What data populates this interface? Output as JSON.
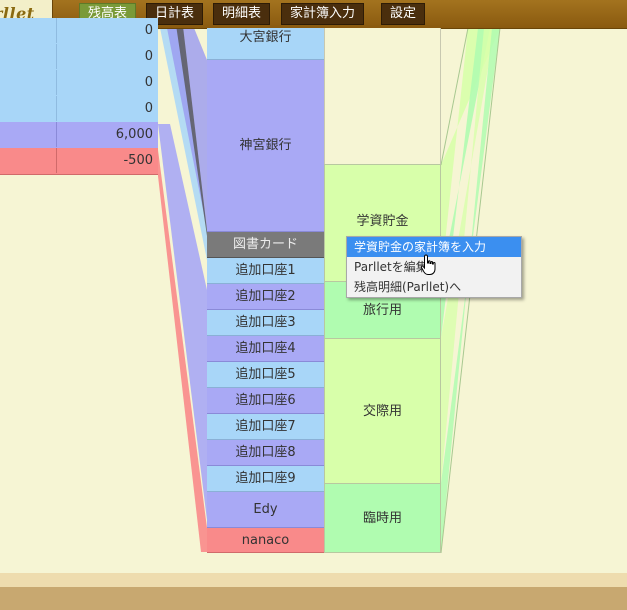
{
  "nav": {
    "logo_text": "rllet",
    "tabs": [
      {
        "label": "残高表",
        "active": true
      },
      {
        "label": "日計表",
        "active": false
      },
      {
        "label": "明細表",
        "active": false
      },
      {
        "label": "家計簿入力",
        "active": false
      },
      {
        "label": "設定",
        "active": false
      }
    ]
  },
  "left_table": {
    "rows": [
      {
        "value": "0",
        "color": "blue"
      },
      {
        "value": "0",
        "color": "blue"
      },
      {
        "value": "0",
        "color": "blue"
      },
      {
        "value": "0",
        "color": "blue"
      },
      {
        "value": "6,000",
        "color": "purple"
      },
      {
        "value": "-500",
        "color": "red"
      }
    ]
  },
  "accounts": [
    {
      "label": "大宮銀行",
      "color": "blue"
    },
    {
      "label": "神宮銀行",
      "color": "purple"
    },
    {
      "label": "図書カード",
      "color": "gray"
    },
    {
      "label": "追加口座1",
      "color": "blue"
    },
    {
      "label": "追加口座2",
      "color": "purple"
    },
    {
      "label": "追加口座3",
      "color": "blue"
    },
    {
      "label": "追加口座4",
      "color": "purple"
    },
    {
      "label": "追加口座5",
      "color": "blue"
    },
    {
      "label": "追加口座6",
      "color": "purple"
    },
    {
      "label": "追加口座7",
      "color": "blue"
    },
    {
      "label": "追加口座8",
      "color": "purple"
    },
    {
      "label": "追加口座9",
      "color": "blue"
    },
    {
      "label": "Edy",
      "color": "purple"
    },
    {
      "label": "nanaco",
      "color": "red"
    }
  ],
  "purposes": [
    {
      "label": "学資貯金",
      "color": "light"
    },
    {
      "label": "旅行用",
      "color": "mint"
    },
    {
      "label": "交際用",
      "color": "light"
    },
    {
      "label": "臨時用",
      "color": "mint"
    }
  ],
  "context_menu": {
    "items": [
      {
        "label": "学資貯金の家計簿を入力",
        "highlighted": true
      },
      {
        "label": "Parlletを編集",
        "highlighted": false
      },
      {
        "label": "残高明細(Parllet)へ",
        "highlighted": false
      }
    ]
  },
  "icons": {
    "cursor": "hand-pointer-icon"
  }
}
